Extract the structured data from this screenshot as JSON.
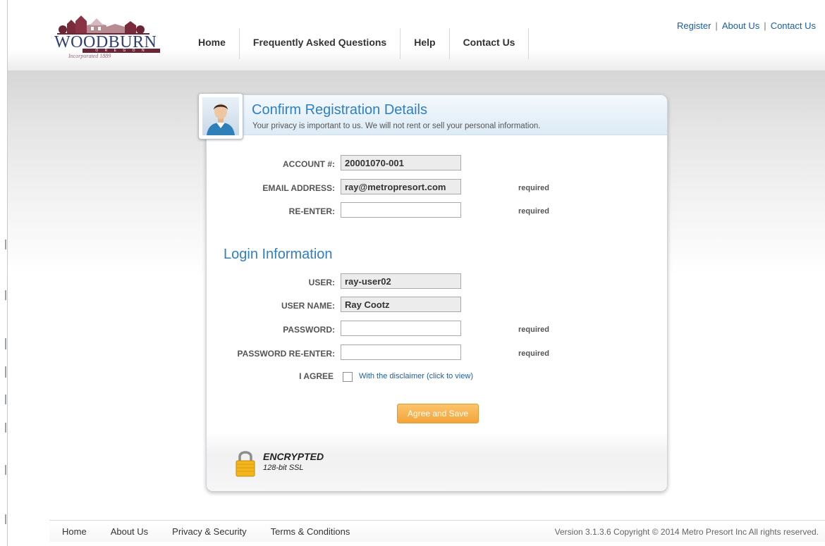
{
  "logo": {
    "wordmark": "WOODBURN",
    "state": "O R E G O N",
    "incorporated": "Incorporated 1889"
  },
  "nav": {
    "items": [
      "Home",
      "Frequently Asked Questions",
      "Help",
      "Contact Us"
    ]
  },
  "top_links": {
    "register": "Register",
    "about": "About Us",
    "contact": "Contact Us",
    "separator": "|"
  },
  "card": {
    "title": "Confirm Registration Details",
    "subtitle": "Your privacy is important to us. We will not rent or sell your personal information.",
    "fields": {
      "account": {
        "label": "ACCOUNT #:",
        "value": "20001070-001"
      },
      "email": {
        "label": "EMAIL ADDRESS:",
        "value": "ray@metropresort.com",
        "note": "required"
      },
      "reenter": {
        "label": "RE-ENTER:",
        "value": "",
        "note": "required"
      }
    },
    "login_title": "Login Information",
    "login": {
      "user": {
        "label": "USER:",
        "value": "ray-user02"
      },
      "user_name": {
        "label": "USER NAME:",
        "value": "Ray Cootz"
      },
      "password": {
        "label": "PASSWORD:",
        "value": "",
        "note": "required"
      },
      "password_reenter": {
        "label": "PASSWORD RE-ENTER:",
        "value": "",
        "note": "required"
      }
    },
    "agree": {
      "label": "I AGREE",
      "link": "With the disclaimer (click to view)"
    },
    "submit": "Agree and Save",
    "security": {
      "title": "ENCRYPTED",
      "subtitle": "128-bit SSL"
    }
  },
  "footer": {
    "links": [
      "Home",
      "About Us",
      "Privacy & Security",
      "Terms & Conditions"
    ],
    "copyright": "Version 3.1.3.6 Copyright © 2014 Metro Presort Inc All rights reserved."
  },
  "colors": {
    "accent": "#2f7fc1",
    "link": "#1a5ea8",
    "button": "#f4a43a",
    "brand": "#2f3f78"
  }
}
